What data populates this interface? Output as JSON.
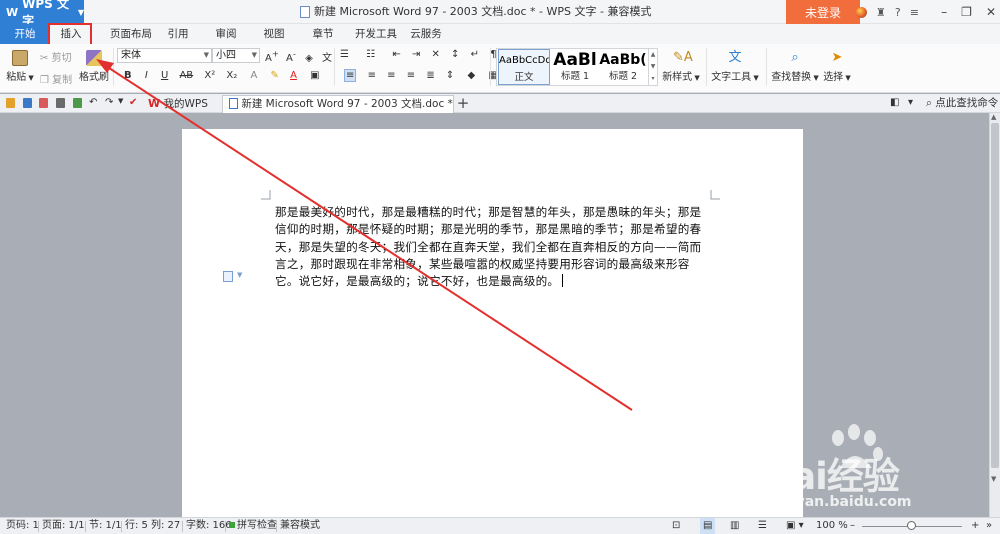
{
  "titlebar": {
    "app_name": "WPS 文字",
    "document_title": "新建 Microsoft Word 97 - 2003 文档.doc * - WPS 文字 - 兼容模式",
    "login_label": "未登录"
  },
  "tabs": [
    "开始",
    "插入",
    "页面布局",
    "引用",
    "审阅",
    "视图",
    "章节",
    "开发工具",
    "云服务"
  ],
  "ribbon": {
    "paste_label": "粘贴",
    "cut_label": "剪切",
    "copy_label": "复制",
    "format_painter_label": "格式刷",
    "font_name": "宋体",
    "font_size": "小四",
    "styles": [
      {
        "preview": "AaBbCcDd",
        "name": "正文"
      },
      {
        "preview": "AaBl",
        "name": "标题 1"
      },
      {
        "preview": "AaBb(",
        "name": "标题 2"
      }
    ],
    "new_style_label": "新样式",
    "text_tools_label": "文字工具",
    "find_replace_label": "查找替换",
    "select_label": "选择"
  },
  "doc_tabs": [
    {
      "label": "我的WPS"
    },
    {
      "label": "新建 Microsoft Word 97 - 2003 文档.doc *"
    }
  ],
  "find_command_label": "点此查找命令",
  "document": {
    "text": "那是最美好的时代，那是最糟糕的时代；那是智慧的年头，那是愚昧的年头；那是信仰的时期，那是怀疑的时期；那是光明的季节，那是黑暗的季节；那是希望的春天，那是失望的冬天；我们全都在直奔天堂，我们全都在直奔相反的方向——简而言之，那时跟现在非常相象，某些最喧嚣的权威坚持要用形容词的最高级来形容它。说它好，是最高级的；说它不好，也是最高级的。"
  },
  "status": {
    "page": "页码: 1",
    "pages": "页面: 1/1",
    "section": "节: 1/1",
    "row": "行: 5",
    "col": "列: 27",
    "word_count": "字数: 166",
    "spell_check": "拼写检查",
    "compat_mode": "兼容模式",
    "zoom": "100 %"
  },
  "watermark": {
    "brand": "Bai经验",
    "url": "jingyan.baidu.com"
  },
  "colors": {
    "accent": "#2f7fd4",
    "login": "#f16d3c",
    "annotation": "#e2302e"
  }
}
